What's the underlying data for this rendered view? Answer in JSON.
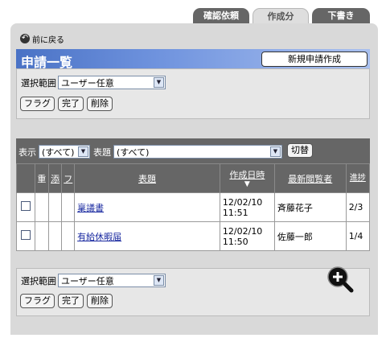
{
  "tabs": [
    {
      "label": "確認依頼"
    },
    {
      "label": "作成分"
    },
    {
      "label": "下書き"
    }
  ],
  "back_label": "前に戻る",
  "title": "申請一覧",
  "new_button": "新規申請作成",
  "scope": {
    "label": "選択範囲",
    "value": "ユーザー任意"
  },
  "actions": [
    "フラグ",
    "完了",
    "削除"
  ],
  "filter": {
    "display_label": "表示",
    "display_value": "(すべて)",
    "subject_label": "表題",
    "subject_value": "(すべて)",
    "toggle_button": "切替"
  },
  "columns": {
    "important": "重",
    "attach": "添",
    "flag": "フ",
    "subject": "表題",
    "created": "作成日時",
    "viewer": "最新閲覧者",
    "progress": "進捗"
  },
  "rows": [
    {
      "subject": "稟議書",
      "date": "12/02/10",
      "time": "11:51",
      "viewer": "斉藤花子",
      "progress": "2/3"
    },
    {
      "subject": "有給休暇届",
      "date": "12/02/10",
      "time": "11:50",
      "viewer": "佐藤一郎",
      "progress": "1/4"
    }
  ],
  "bottom_scope": {
    "label": "選択範囲",
    "value": "ユーザー任意"
  },
  "bottom_actions": [
    "フラグ",
    "完了",
    "削除"
  ],
  "colors": {
    "accent": "#4a72c5",
    "panel": "#d9d9d9",
    "header": "#666666"
  }
}
